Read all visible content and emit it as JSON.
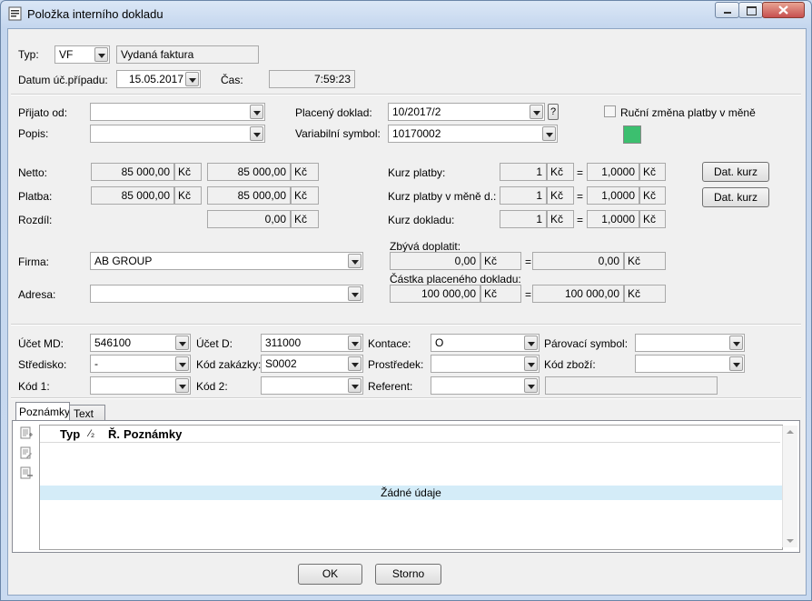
{
  "window": {
    "title": "Položka interního dokladu"
  },
  "header": {
    "typ_label": "Typ:",
    "typ_value": "VF",
    "typ_name": "Vydaná faktura",
    "datum_label": "Datum úč.případu:",
    "datum_value": "15.05.2017",
    "cas_label": "Čas:",
    "cas_value": "7:59:23"
  },
  "main": {
    "prijato_label": "Přijato od:",
    "prijato_value": "",
    "popis_label": "Popis:",
    "popis_value": "",
    "placeny_label": "Placený doklad:",
    "placeny_value": "10/2017/2",
    "help_label": "?",
    "variabilni_label": "Variabilní symbol:",
    "variabilni_value": "10170002",
    "rucni_label": "Ruční změna platby v měně",
    "status_color": "#3cbf6f",
    "netto_label": "Netto:",
    "netto_1": "85 000,00",
    "netto_2": "85 000,00",
    "platba_label": "Platba:",
    "platba_1": "85 000,00",
    "platba_2": "85 000,00",
    "rozdil_label": "Rozdíl:",
    "rozdil_value": "0,00",
    "currency": "Kč",
    "kurz_platby_label": "Kurz platby:",
    "kurz_platby_amount": "1",
    "kurz_platby_rate": "1,0000",
    "kurz_mena_label": "Kurz platby v měně d.:",
    "kurz_mena_amount": "1",
    "kurz_mena_rate": "1,0000",
    "kurz_dokladu_label": "Kurz dokladu:",
    "kurz_dokladu_amount": "1",
    "kurz_dokladu_rate": "1,0000",
    "dat_kurz_label": "Dat. kurz",
    "eq": "=",
    "firma_label": "Firma:",
    "firma_value": "AB GROUP",
    "adresa_label": "Adresa:",
    "adresa_value": "",
    "zbyva_label": "Zbývá doplatit:",
    "zbyva_1": "0,00",
    "zbyva_2": "0,00",
    "castka_label": "Částka placeného dokladu:",
    "castka_1": "100 000,00",
    "castka_2": "100 000,00"
  },
  "accounts": {
    "ucet_md_label": "Účet MD:",
    "ucet_md_value": "546100",
    "ucet_d_label": "Účet D:",
    "ucet_d_value": "311000",
    "kontace_label": "Kontace:",
    "kontace_value": "O",
    "parovaci_label": "Párovací symbol:",
    "parovaci_value": "",
    "stredisko_label": "Středisko:",
    "stredisko_value": "-",
    "kod_zakazky_label": "Kód zakázky:",
    "kod_zakazky_value": "S0002",
    "prostredek_label": "Prostředek:",
    "prostredek_value": "",
    "kod_zbozi_label": "Kód zboží:",
    "kod_zbozi_value": "",
    "kod1_label": "Kód 1:",
    "kod1_value": "",
    "kod2_label": "Kód 2:",
    "kod2_value": "",
    "referent_label": "Referent:",
    "referent_value": ""
  },
  "tabs": [
    {
      "label": "Poznámky"
    },
    {
      "label": "Text"
    }
  ],
  "notes_table": {
    "columns": [
      "Typ",
      "⁄₂",
      "Ř.",
      "Poznámky"
    ],
    "empty_text": "Žádné údaje"
  },
  "footer": {
    "ok_label": "OK",
    "cancel_label": "Storno"
  }
}
